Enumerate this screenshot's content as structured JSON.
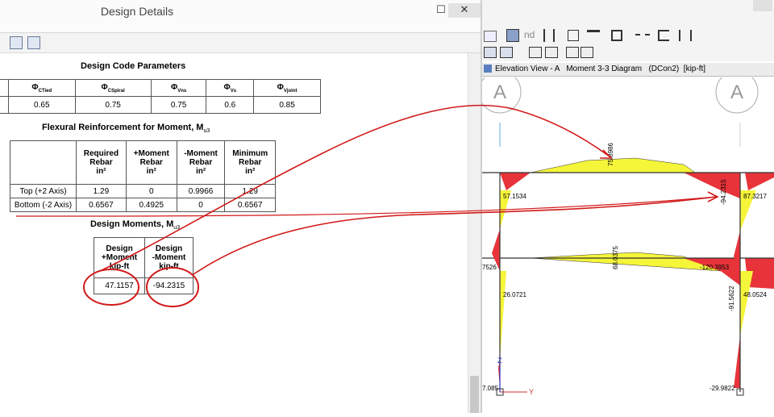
{
  "left_window": {
    "title": "Design Details",
    "controls": {
      "close": "✕",
      "restore": "☐"
    }
  },
  "design_code": {
    "heading": "Design Code Parameters",
    "headers": [
      "CTied",
      "CSpiral",
      "Vns",
      "Vs",
      "Vjoint"
    ],
    "phi_symbol": "Φ",
    "values": [
      "0.65",
      "0.75",
      "0.75",
      "0.6",
      "0.85"
    ]
  },
  "flexural": {
    "heading": "Flexural Reinforcement for Moment, M",
    "heading_sub": "u3",
    "col_headers": [
      [
        "Required",
        "Rebar",
        "in²"
      ],
      [
        "+Moment",
        "Rebar",
        "in²"
      ],
      [
        "-Moment",
        "Rebar",
        "in²"
      ],
      [
        "Minimum",
        "Rebar",
        "in²"
      ]
    ],
    "rows": [
      {
        "label": "Top (+2 Axis)",
        "values": [
          "1.29",
          "0",
          "0.9966",
          "1.29"
        ]
      },
      {
        "label": "Bottom (-2 Axis)",
        "values": [
          "0.6567",
          "0.4925",
          "0",
          "0.6567"
        ]
      }
    ]
  },
  "design_moments": {
    "heading": "Design Moments, M",
    "heading_sub": "u3",
    "col_headers": [
      [
        "Design",
        "+Moment",
        "kip-ft"
      ],
      [
        "Design",
        "-Moment",
        "kip-ft"
      ]
    ],
    "values": [
      "47.1157",
      "-94.2315"
    ]
  },
  "right_window": {
    "toolbar_text": "nd",
    "tab_label": "Elevation View - A   Moment 3-3 Diagram   (DCon2)  [kip-ft]",
    "grid_label_left": "A",
    "grid_label_right": "A",
    "axis_z": "Z",
    "axis_y": "Y",
    "moment_labels": {
      "top_beam_mid": "75.8986",
      "top_beam_right": "-94.2315",
      "upper_col_left": "57.1534",
      "upper_col_right": "87.3217",
      "lower_beam_mid": "68.0375",
      "lower_beam_right": "-120.3953",
      "lower_beam_left": "7526",
      "lower_col_left": "26.0721",
      "lower_col_right": "48.0524",
      "lower_col_right_neg": "-91.5622",
      "base_left": "7.085",
      "base_right": "-29.9822"
    },
    "colors": {
      "positive": "#f5f53a",
      "negative": "#e8333a",
      "annotation": "#d21919"
    }
  }
}
